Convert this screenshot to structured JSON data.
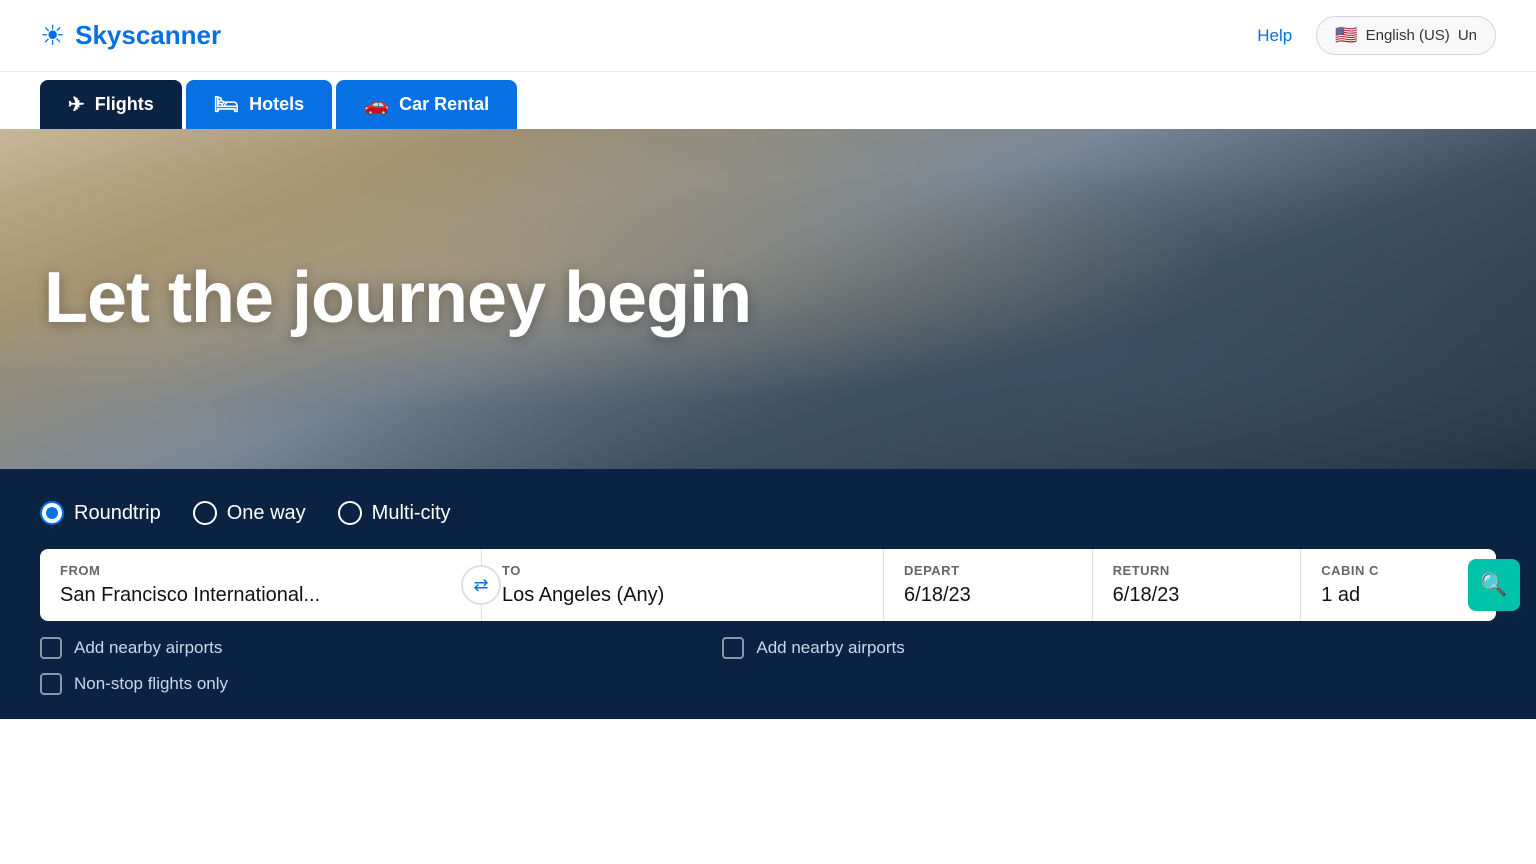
{
  "header": {
    "logo_text": "Skyscanner",
    "help_label": "Help",
    "language_label": "English (US)",
    "flag_emoji": "🇺🇸",
    "currency_label": "Un"
  },
  "nav": {
    "tabs": [
      {
        "id": "flights",
        "label": "Flights",
        "icon": "✈",
        "active": true,
        "style": "active"
      },
      {
        "id": "hotels",
        "label": "Hotels",
        "icon": "🛏",
        "active": false,
        "style": "hotels"
      },
      {
        "id": "car-rental",
        "label": "Car Rental",
        "icon": "🚗",
        "active": false,
        "style": "car-rental"
      }
    ]
  },
  "hero": {
    "tagline": "Let the journey begin"
  },
  "search": {
    "trip_types": [
      {
        "id": "roundtrip",
        "label": "Roundtrip",
        "selected": true
      },
      {
        "id": "one-way",
        "label": "One way",
        "selected": false
      },
      {
        "id": "multi-city",
        "label": "Multi-city",
        "selected": false
      }
    ],
    "fields": {
      "from_label": "From",
      "from_value": "San Francisco International...",
      "to_label": "To",
      "to_value": "Los Angeles (Any)",
      "depart_label": "Depart",
      "depart_value": "6/18/23",
      "return_label": "Return",
      "return_value": "6/18/23",
      "cabin_label": "Cabin C",
      "cabin_value": "1 ad"
    },
    "checkboxes": {
      "nearby_from_label": "Add nearby airports",
      "nearby_to_label": "Add nearby airports",
      "nonstop_label": "Non-stop flights only"
    },
    "swap_icon": "⇄"
  }
}
